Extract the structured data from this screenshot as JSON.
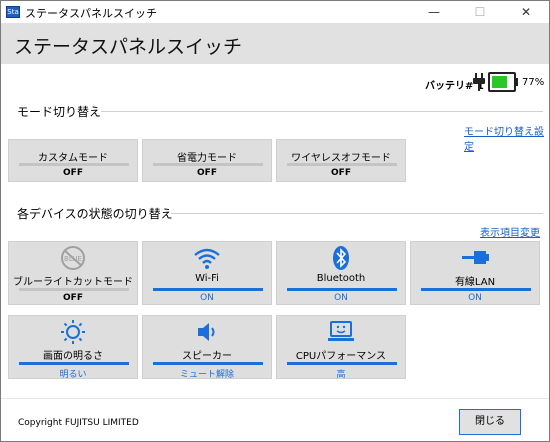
{
  "window": {
    "title": "ステータスパネルスイッチ",
    "minimize": "—",
    "maximize": "☐",
    "close": "✕",
    "icon_text": "Sta"
  },
  "header": {
    "title": "ステータスパネルスイッチ"
  },
  "battery": {
    "label": "バッテリ# 1",
    "percent_text": "77%",
    "level": 0.77,
    "color": "#28c828"
  },
  "mode_section": {
    "title": "モード切り替え",
    "settings_link": "モード切り替え設定",
    "modes": [
      {
        "label": "カスタムモード",
        "state": "OFF"
      },
      {
        "label": "省電力モード",
        "state": "OFF"
      },
      {
        "label": "ワイヤレスオフモード",
        "state": "OFF"
      }
    ]
  },
  "device_section": {
    "title": "各デバイスの状態の切り替え",
    "display_link": "表示項目変更",
    "tiles": [
      {
        "label": "ブルーライトカットモード",
        "state": "OFF",
        "icon": "blue-light-off-icon"
      },
      {
        "label": "Wi-Fi",
        "state": "ON",
        "icon": "wifi-icon"
      },
      {
        "label": "Bluetooth",
        "state": "ON",
        "icon": "bluetooth-icon"
      },
      {
        "label": "有線LAN",
        "state": "ON",
        "icon": "wired-lan-icon"
      },
      {
        "label": "画面の明るさ",
        "state": "明るい",
        "icon": "brightness-icon"
      },
      {
        "label": "スピーカー",
        "state": "ミュート解除",
        "icon": "speaker-icon"
      },
      {
        "label": "CPUパフォーマンス",
        "state": "高",
        "icon": "cpu-performance-icon"
      }
    ]
  },
  "footer": {
    "copyright": "Copyright FUJITSU LIMITED",
    "close_label": "閉じる"
  },
  "colors": {
    "accent": "#1a6fd9",
    "tile_bg": "#dedede",
    "header_bg": "#e1e1e1"
  }
}
